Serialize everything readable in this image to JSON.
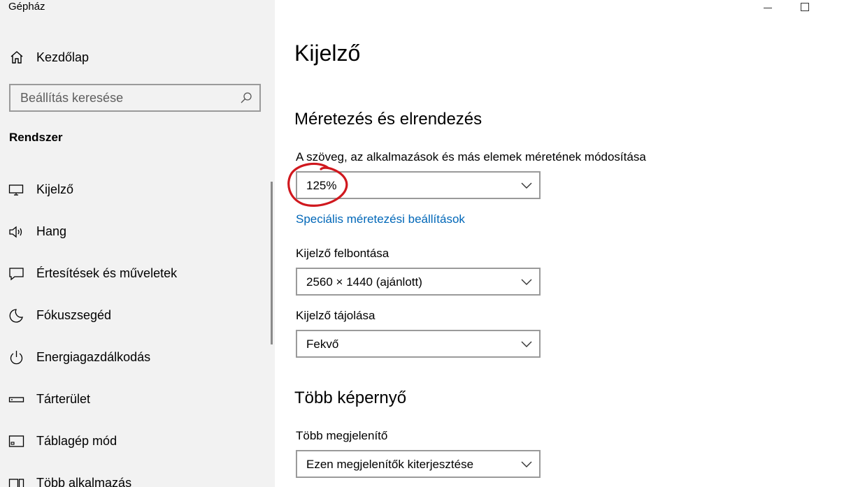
{
  "app": {
    "title": "Gépház"
  },
  "sidebar": {
    "home_label": "Kezdőlap",
    "search_placeholder": "Beállítás keresése",
    "section_title": "Rendszer",
    "items": [
      {
        "label": "Kijelző",
        "icon": "monitor-icon"
      },
      {
        "label": "Hang",
        "icon": "speaker-icon"
      },
      {
        "label": "Értesítések és műveletek",
        "icon": "message-icon"
      },
      {
        "label": "Fókuszsegéd",
        "icon": "moon-icon"
      },
      {
        "label": "Energiagazdálkodás",
        "icon": "power-icon"
      },
      {
        "label": "Tárterület",
        "icon": "storage-icon"
      },
      {
        "label": "Táblagép mód",
        "icon": "tablet-icon"
      },
      {
        "label": "Több alkalmazás",
        "icon": "multitask-icon"
      }
    ]
  },
  "main": {
    "title": "Kijelző",
    "scale_section": {
      "heading": "Méretezés és elrendezés",
      "scale_label": "A szöveg, az alkalmazások és más elemek méretének módosítása",
      "scale_value": "125%",
      "advanced_link": "Speciális méretezési beállítások",
      "resolution_label": "Kijelző felbontása",
      "resolution_value": "2560 × 1440 (ajánlott)",
      "orientation_label": "Kijelző tájolása",
      "orientation_value": "Fekvő"
    },
    "multi_section": {
      "heading": "Több képernyő",
      "multi_label": "Több megjelenítő",
      "multi_value": "Ezen megjelenítők kiterjesztése"
    }
  },
  "colors": {
    "sidebar_bg": "#f2f2f2",
    "link": "#0067b8",
    "annotation": "#d0181e",
    "border": "#9a9a9a"
  }
}
